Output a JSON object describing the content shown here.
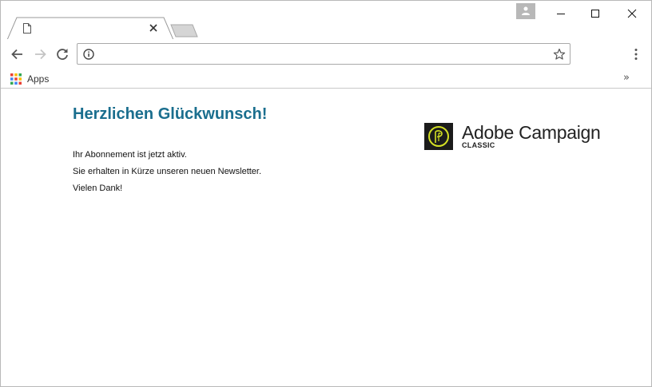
{
  "browser": {
    "tab": {
      "title": ""
    },
    "address": {
      "value": ""
    },
    "bookmarks": {
      "apps_label": "Apps",
      "overflow": "»"
    }
  },
  "page": {
    "heading": "Herzlichen Glückwunsch!",
    "paragraphs": [
      "Ihr Abonnement ist jetzt aktiv.",
      "Sie erhalten in Kürze unseren neuen Newsletter.",
      "Vielen Dank!"
    ],
    "logo": {
      "title": "Adobe Campaign",
      "subtitle": "CLASSIC"
    }
  },
  "colors": {
    "heading": "#1a6e8e",
    "logo_accent": "#d4e024",
    "logo_bg": "#1b1b1b"
  },
  "icons": {
    "tab": "document-icon",
    "close": "close-icon",
    "back": "arrow-left-icon",
    "forward": "arrow-right-icon",
    "reload": "reload-icon",
    "info": "info-icon",
    "star": "star-icon",
    "menu": "kebab-menu-icon",
    "apps": "apps-grid-icon",
    "profile": "person-icon"
  }
}
